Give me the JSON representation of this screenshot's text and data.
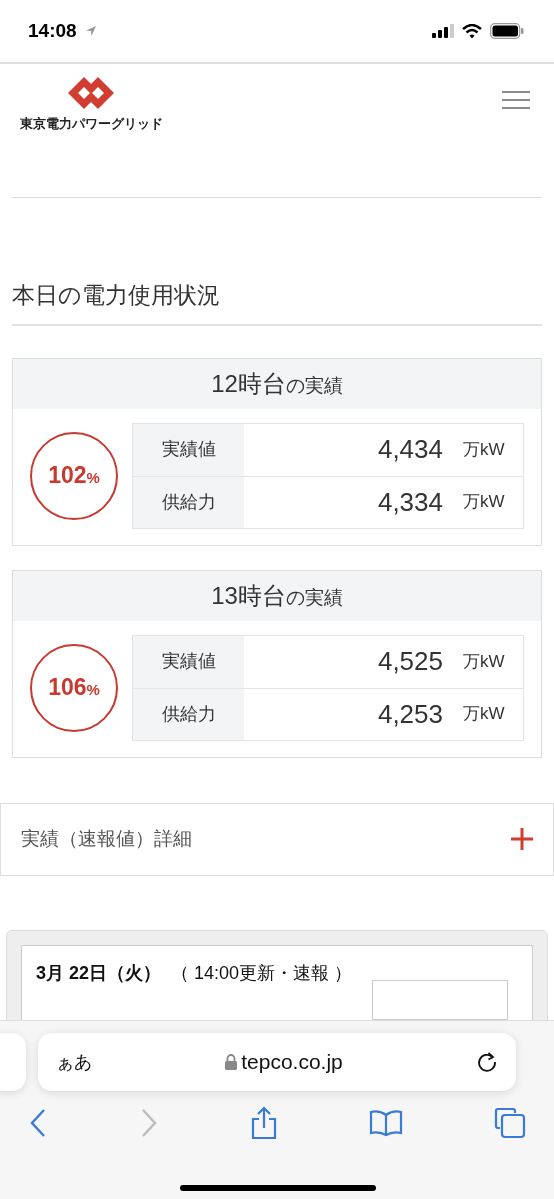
{
  "status_bar": {
    "time": "14:08"
  },
  "header": {
    "logo_text": "東京電力パワーグリッド"
  },
  "section_title": "本日の電力使用状況",
  "hours": [
    {
      "hour": "12時台",
      "suffix": "の実績",
      "percent": "102",
      "percent_unit": "%",
      "rows": [
        {
          "label": "実績値",
          "value": "4,434",
          "unit": "万kW"
        },
        {
          "label": "供給力",
          "value": "4,334",
          "unit": "万kW"
        }
      ]
    },
    {
      "hour": "13時台",
      "suffix": "の実績",
      "percent": "106",
      "percent_unit": "%",
      "rows": [
        {
          "label": "実績値",
          "value": "4,525",
          "unit": "万kW"
        },
        {
          "label": "供給力",
          "value": "4,253",
          "unit": "万kW"
        }
      ]
    }
  ],
  "accordion": {
    "label": "実績（速報値）詳細",
    "expanded": false
  },
  "update_card": {
    "date": "3月 22日（火）",
    "note": "（ 14:00更新・速報 ）"
  },
  "browser": {
    "text_size": "ぁあ",
    "url": "tepco.co.jp",
    "forward_disabled": true
  }
}
